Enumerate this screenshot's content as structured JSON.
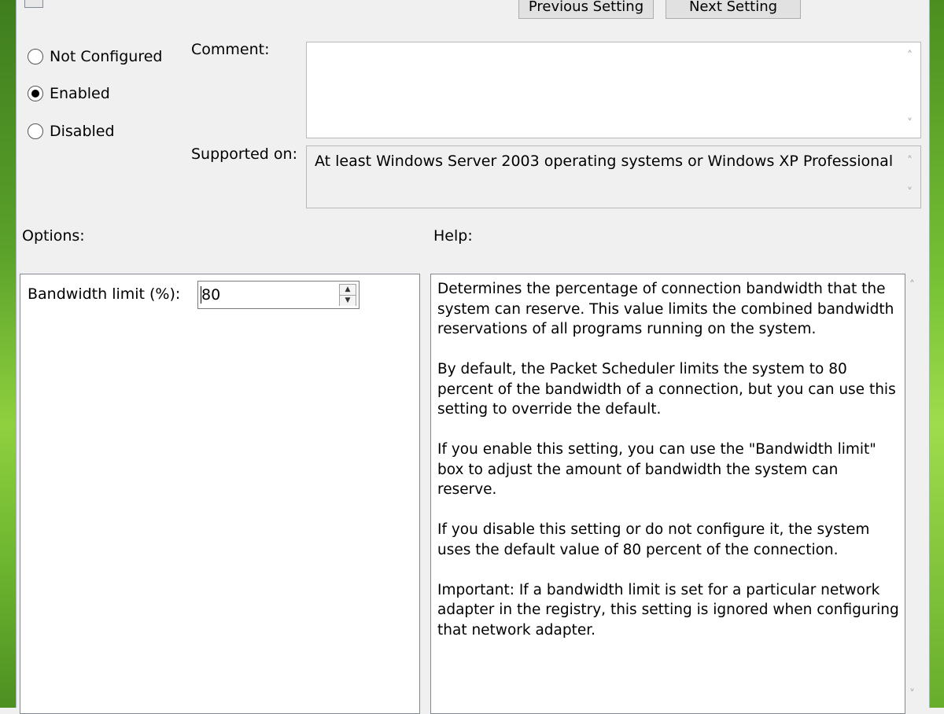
{
  "nav": {
    "previous_label": "Previous Setting",
    "next_label": "Next Setting"
  },
  "state": {
    "options": [
      "Not Configured",
      "Enabled",
      "Disabled"
    ],
    "selected": "Enabled",
    "not_configured_label": "Not Configured",
    "enabled_label": "Enabled",
    "disabled_label": "Disabled"
  },
  "comment": {
    "label": "Comment:",
    "value": ""
  },
  "supported": {
    "label": "Supported on:",
    "value": "At least Windows Server 2003 operating systems or Windows XP Professional"
  },
  "options_section": {
    "title": "Options:",
    "bandwidth_label": "Bandwidth limit (%):",
    "bandwidth_value": "80"
  },
  "help_section": {
    "title": "Help:",
    "paragraphs": [
      "Determines the percentage of connection bandwidth that the system can reserve. This value limits the combined bandwidth reservations of all programs running on the system.",
      "By default, the Packet Scheduler limits the system to 80 percent of the bandwidth of a connection, but you can use this setting to override the default.",
      "If you enable this setting, you can use the \"Bandwidth limit\" box to adjust the amount of bandwidth the system can reserve.",
      "If you disable this setting or do not configure it, the system uses the default value of 80 percent of the connection.",
      "Important: If a bandwidth limit is set for a particular network adapter in the registry, this setting is ignored when configuring that network adapter."
    ]
  },
  "icons": {
    "scroll_up": "scroll-up-icon",
    "scroll_down": "scroll-down-icon",
    "spin_up": "spin-up-icon",
    "spin_down": "spin-down-icon"
  }
}
